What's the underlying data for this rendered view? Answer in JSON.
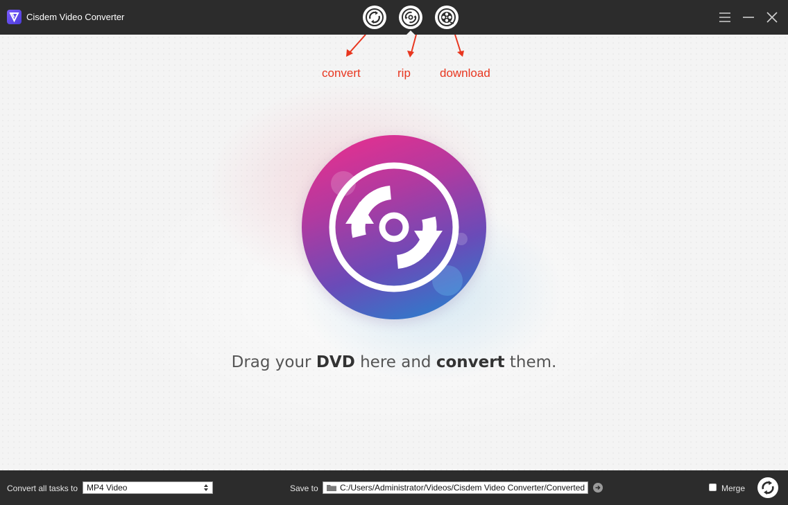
{
  "window": {
    "title": "Cisdem Video Converter",
    "logo_icon": "cisdem-logo-icon"
  },
  "modes": {
    "convert_icon": "convert-arrows-icon",
    "rip_icon": "disc-rip-icon",
    "download_icon": "film-reel-icon",
    "active": "rip"
  },
  "annotations": {
    "convert": "convert",
    "rip": "rip",
    "download": "download",
    "color": "#e8361f"
  },
  "main": {
    "hint_part1": "Drag your ",
    "hint_bold1": "DVD",
    "hint_part2": " here and ",
    "hint_bold2": "convert",
    "hint_part3": " them.",
    "drop_icon": "disc-convert-icon"
  },
  "bottombar": {
    "convert_all_label": "Convert all tasks to",
    "format_value": "MP4 Video",
    "save_to_label": "Save to",
    "save_path": "C:/Users/Administrator/Videos/Cisdem Video Converter/Converted",
    "merge_label": "Merge",
    "merge_checked": false
  },
  "colors": {
    "titlebar": "#2c2c2c",
    "background": "#f4f4f4",
    "accent_pink": "#ef2e8c",
    "accent_blue": "#1f88d0"
  }
}
